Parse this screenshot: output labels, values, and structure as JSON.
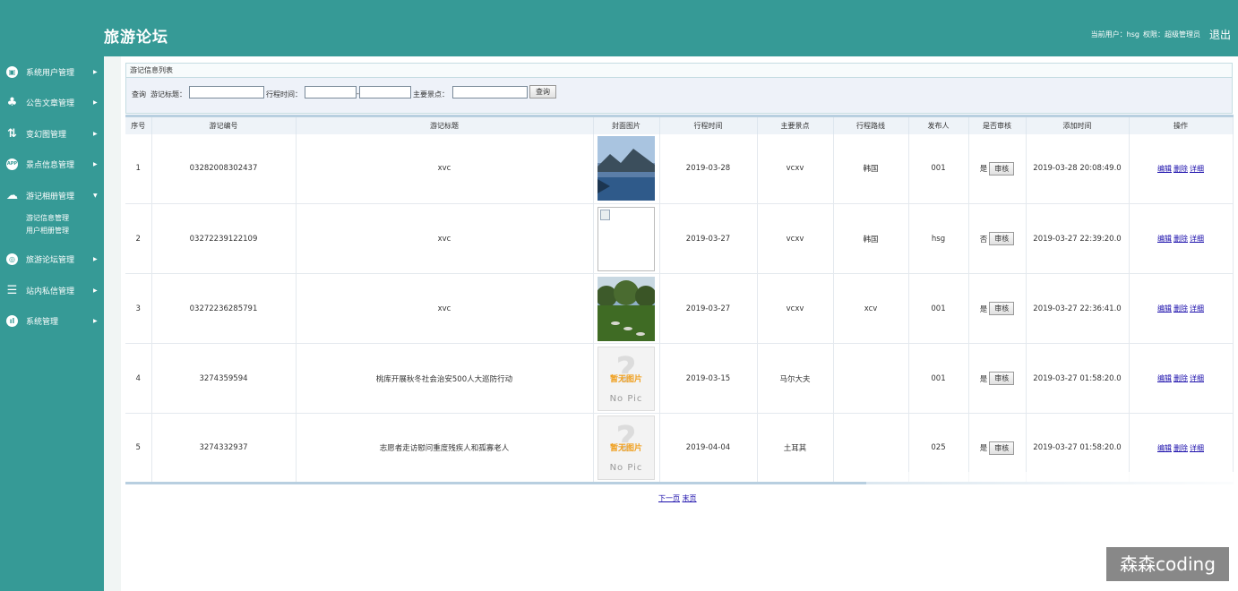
{
  "header": {
    "title": "旅游论坛",
    "user_label": "当前用户：hsg",
    "role_label": "权限：超级管理员",
    "logout": "退出"
  },
  "sidebar": {
    "items": [
      {
        "label": "系统用户管理",
        "icon": "monitor-icon"
      },
      {
        "label": "公告文章管理",
        "icon": "user-add-icon"
      },
      {
        "label": "变幻图管理",
        "icon": "slideshow-icon"
      },
      {
        "label": "景点信息管理",
        "icon": "app-icon"
      },
      {
        "label": "游记相册管理",
        "icon": "cloud-icon"
      },
      {
        "label": "旅游论坛管理",
        "icon": "forum-icon"
      },
      {
        "label": "站内私信管理",
        "icon": "message-stack-icon"
      },
      {
        "label": "系统管理",
        "icon": "stats-icon"
      }
    ],
    "subitems": [
      "游记信息管理",
      "用户相册管理"
    ]
  },
  "panel": {
    "title": "游记信息列表"
  },
  "search": {
    "prefix": "查询",
    "title_label": "游记标题：",
    "title_value": "",
    "date_label": "行程时间：",
    "date_from": "",
    "date_sep": "-",
    "date_to": "",
    "spot_label": "主要景点：",
    "spot_value": "",
    "button": "查询"
  },
  "table": {
    "headers": [
      "序号",
      "游记编号",
      "游记标题",
      "封面图片",
      "行程时间",
      "主要景点",
      "行程路线",
      "发布人",
      "是否审核",
      "添加时间",
      "操作"
    ],
    "rows": [
      {
        "no": "1",
        "code": "03282008302437",
        "title": "xvc",
        "cover": "lake-photo",
        "date": "2019-03-28",
        "spot": "vcxv",
        "route": "韩国",
        "author": "001",
        "approved": "是",
        "added": "2019-03-28 20:08:49.0"
      },
      {
        "no": "2",
        "code": "03272239122109",
        "title": "xvc",
        "cover": "broken-image",
        "date": "2019-03-27",
        "spot": "vcxv",
        "route": "韩国",
        "author": "hsg",
        "approved": "否",
        "added": "2019-03-27 22:39:20.0"
      },
      {
        "no": "3",
        "code": "03272236285791",
        "title": "xvc",
        "cover": "park-photo",
        "date": "2019-03-27",
        "spot": "vcxv",
        "route": "xcv",
        "author": "001",
        "approved": "是",
        "added": "2019-03-27 22:36:41.0"
      },
      {
        "no": "4",
        "code": "3274359594",
        "title": "桃库开展秋冬社会治安500人大巡防行动",
        "cover": "no-pic",
        "date": "2019-03-15",
        "spot": "马尔大夫",
        "route": "",
        "author": "001",
        "approved": "是",
        "added": "2019-03-27 01:58:20.0"
      },
      {
        "no": "5",
        "code": "3274332937",
        "title": "志愿者走访慰问重度残疾人和孤寡老人",
        "cover": "no-pic",
        "date": "2019-04-04",
        "spot": "土耳其",
        "route": "",
        "author": "025",
        "approved": "是",
        "added": "2019-03-27 01:58:20.0"
      }
    ],
    "audit_button": "审核",
    "ops": [
      "编辑",
      "删除",
      "详细"
    ],
    "nopic_cn": "暂无图片",
    "nopic_en": "No Pic"
  },
  "pager": {
    "next": "下一页",
    "last": "末页"
  },
  "watermark": "森森coding",
  "colors": {
    "theme": "#369a96"
  }
}
